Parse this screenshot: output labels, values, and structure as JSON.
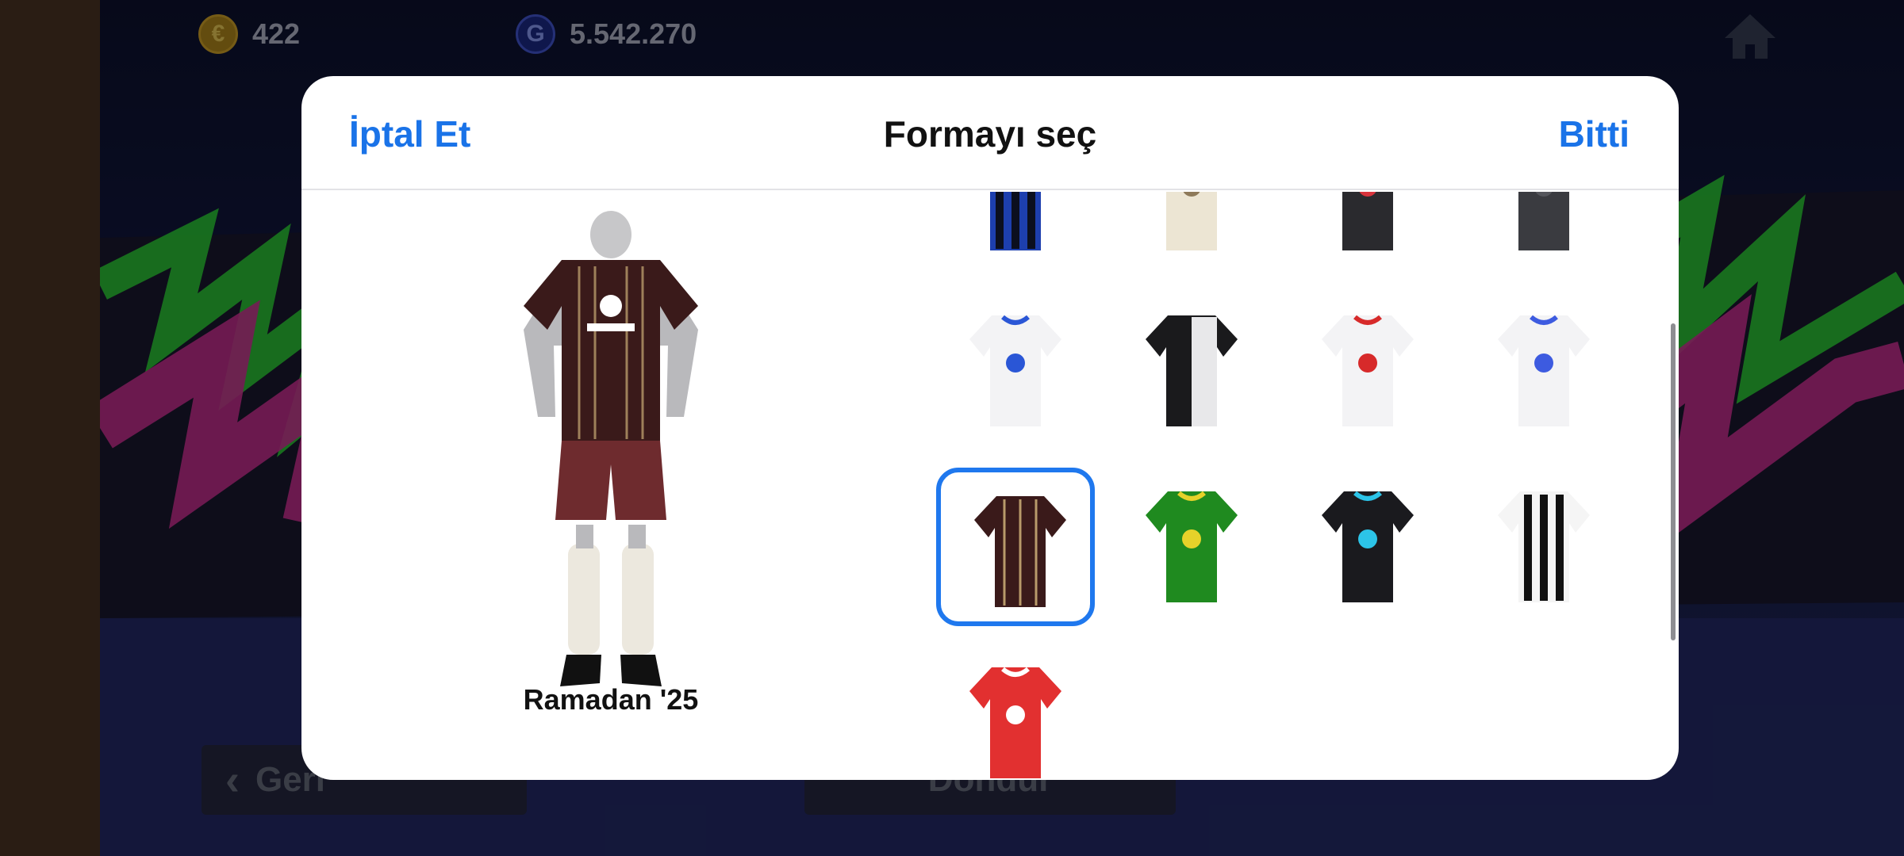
{
  "top_bar": {
    "efootball_points": "422",
    "gp": "5.542.270",
    "efootball_coin_icon": "efootball-coin-icon",
    "gp_coin_icon": "gp-coin-icon",
    "home_icon": "home-icon"
  },
  "background_buttons": {
    "back_label": "Geri",
    "center_label": "Döndür"
  },
  "dialog": {
    "cancel_label": "İptal Et",
    "title": "Formayı seç",
    "done_label": "Bitti"
  },
  "preview": {
    "kit_name": "Ramadan '25"
  },
  "kits": [
    {
      "id": "kit-1",
      "primary": "#1d3fae",
      "secondary": "#0b0f1e",
      "pattern": "stripes",
      "selected": false
    },
    {
      "id": "kit-2",
      "primary": "#ece5d3",
      "secondary": "#8e7a5a",
      "pattern": "dots",
      "selected": false
    },
    {
      "id": "kit-3",
      "primary": "#2a2a2e",
      "secondary": "#d8333c",
      "pattern": "graphic",
      "selected": false
    },
    {
      "id": "kit-4",
      "primary": "#3a3b40",
      "secondary": "#55565c",
      "pattern": "plain-dark",
      "selected": false
    },
    {
      "id": "kit-5",
      "primary": "#f3f3f5",
      "secondary": "#2a56d6",
      "pattern": "collar",
      "selected": false
    },
    {
      "id": "kit-6",
      "primary": "#1a1a1c",
      "secondary": "#e8e8ea",
      "pattern": "split",
      "selected": false
    },
    {
      "id": "kit-7",
      "primary": "#f3f3f5",
      "secondary": "#d72a2a",
      "pattern": "center",
      "selected": false
    },
    {
      "id": "kit-8",
      "primary": "#f3f3f5",
      "secondary": "#3d5be0",
      "pattern": "collar-multi",
      "selected": false
    },
    {
      "id": "kit-9",
      "primary": "#3a1a1a",
      "secondary": "#b89a6a",
      "pattern": "stripes-thin",
      "selected": true
    },
    {
      "id": "kit-10",
      "primary": "#1f8a1f",
      "secondary": "#e6d22a",
      "pattern": "swirl",
      "selected": false
    },
    {
      "id": "kit-11",
      "primary": "#1a1a1e",
      "secondary": "#2cc4e8",
      "pattern": "burst",
      "selected": false
    },
    {
      "id": "kit-12",
      "primary": "#f5f5f5",
      "secondary": "#111111",
      "pattern": "stripes",
      "selected": false
    },
    {
      "id": "kit-13",
      "primary": "#e23030",
      "secondary": "#ffffff",
      "pattern": "graphic",
      "selected": false
    }
  ],
  "colors": {
    "accent": "#1a73e8",
    "selection_border": "#1f78ee"
  }
}
